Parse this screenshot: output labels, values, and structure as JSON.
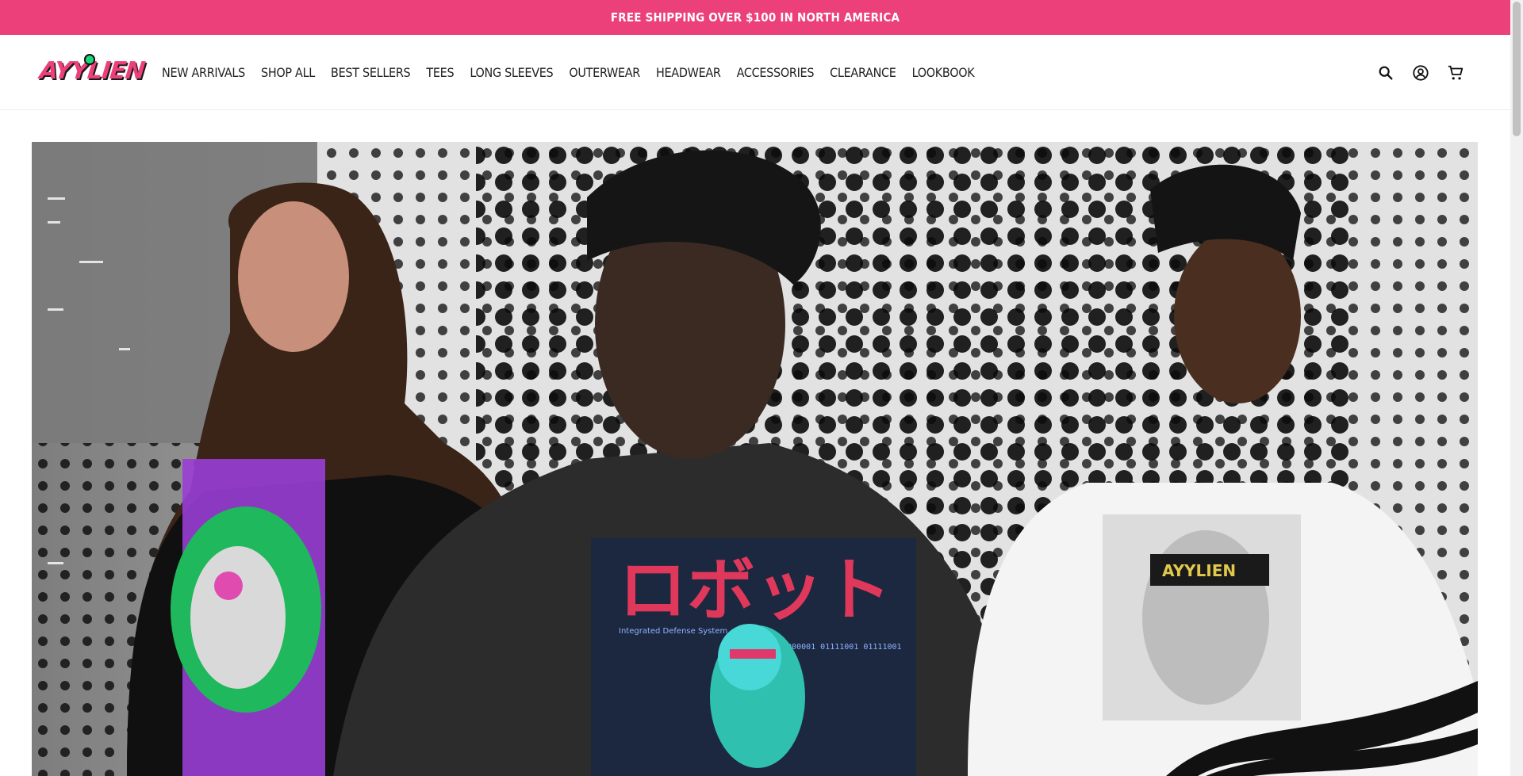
{
  "announcement": {
    "text": "FREE SHIPPING OVER $100 IN NORTH AMERICA"
  },
  "brand": {
    "logo_text": "AYYLIEN",
    "accent_color": "#ec407a",
    "alien_color": "#1bd67a"
  },
  "nav": {
    "items": [
      {
        "label": "NEW ARRIVALS"
      },
      {
        "label": "SHOP ALL"
      },
      {
        "label": "BEST SELLERS"
      },
      {
        "label": "TEES"
      },
      {
        "label": "LONG SLEEVES"
      },
      {
        "label": "OUTERWEAR"
      },
      {
        "label": "HEADWEAR"
      },
      {
        "label": "ACCESSORIES"
      },
      {
        "label": "CLEARANCE"
      },
      {
        "label": "LOOKBOOK"
      }
    ]
  },
  "header_icons": [
    {
      "name": "search-icon"
    },
    {
      "name": "account-icon"
    },
    {
      "name": "cart-icon"
    }
  ],
  "hero": {
    "jacket_text": "ロボット",
    "jacket_subtext": "Integrated Defense System",
    "jacket_binary": "01000001 01111001 01111001",
    "sweatshirt_print": "AYYLIEN"
  }
}
